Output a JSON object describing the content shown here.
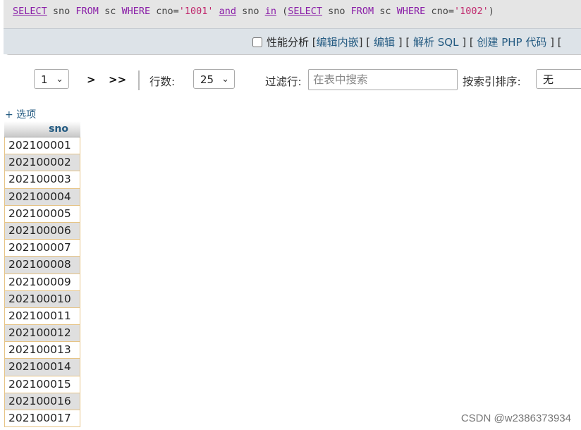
{
  "sql": {
    "tokens": [
      {
        "t": "SELECT",
        "c": "kw"
      },
      {
        "t": " sno ",
        "c": "plain"
      },
      {
        "t": "FROM",
        "c": "kw2"
      },
      {
        "t": " sc ",
        "c": "plain"
      },
      {
        "t": "WHERE",
        "c": "kw2"
      },
      {
        "t": " cno=",
        "c": "plain"
      },
      {
        "t": "'1001'",
        "c": "str"
      },
      {
        "t": " ",
        "c": "plain"
      },
      {
        "t": "and",
        "c": "kw"
      },
      {
        "t": " sno ",
        "c": "plain"
      },
      {
        "t": "in",
        "c": "kw"
      },
      {
        "t": " (",
        "c": "plain"
      },
      {
        "t": "SELECT",
        "c": "kw"
      },
      {
        "t": " sno ",
        "c": "plain"
      },
      {
        "t": "FROM",
        "c": "kw2"
      },
      {
        "t": " sc ",
        "c": "plain"
      },
      {
        "t": "WHERE",
        "c": "kw2"
      },
      {
        "t": " cno=",
        "c": "plain"
      },
      {
        "t": "'1002'",
        "c": "str"
      },
      {
        "t": ")",
        "c": "plain"
      }
    ],
    "profiling_label": "性能分析",
    "inline_edit": "编辑内嵌",
    "edit": "编辑",
    "explain": "解析 SQL",
    "create_php": "创建 PHP 代码"
  },
  "nav": {
    "page_value": "1",
    "next": ">",
    "last": ">>",
    "rows_label": "行数:",
    "rows_value": "25",
    "filter_label": "过滤行:",
    "filter_placeholder": "在表中搜索",
    "sort_label": "按索引排序:",
    "sort_value": "无"
  },
  "options_link": "+ 选项",
  "table": {
    "header": "sno",
    "rows": [
      "202100001",
      "202100002",
      "202100003",
      "202100004",
      "202100005",
      "202100006",
      "202100007",
      "202100008",
      "202100009",
      "202100010",
      "202100011",
      "202100012",
      "202100013",
      "202100014",
      "202100015",
      "202100016",
      "202100017"
    ]
  },
  "watermark": "CSDN @w2386373934",
  "colors": {
    "link": "#235a81",
    "keyword": "#8a1fa8",
    "string": "#c0286c",
    "row_even": "#dfdfdf"
  }
}
